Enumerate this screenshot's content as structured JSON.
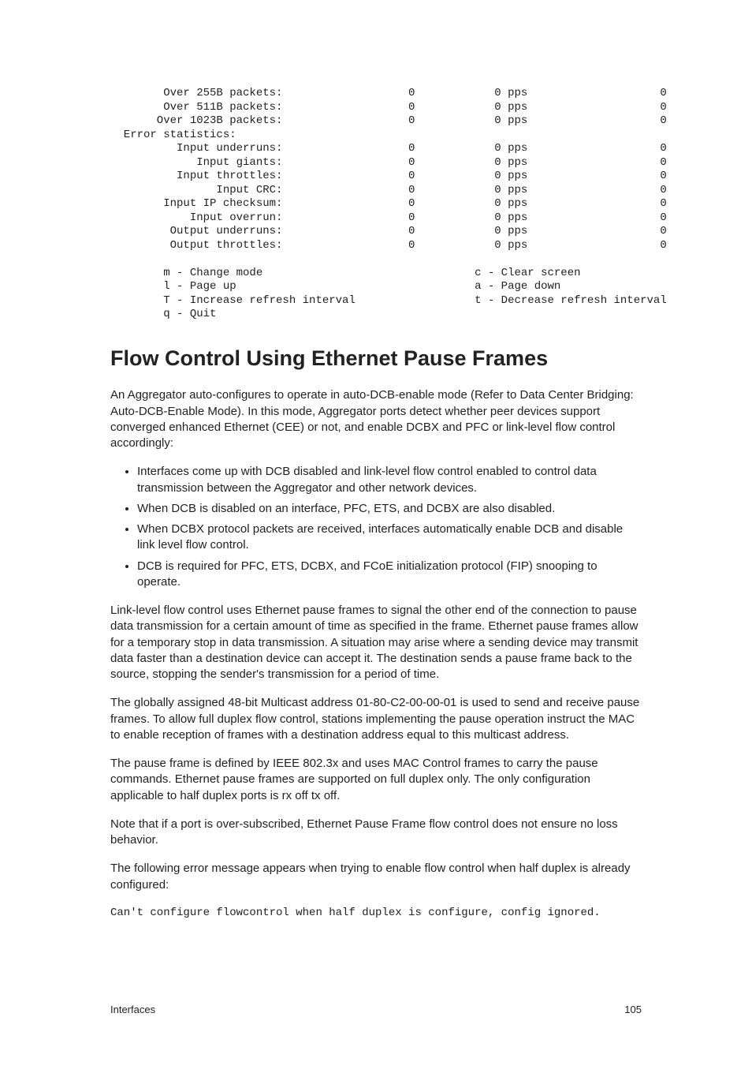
{
  "stats": {
    "rows": [
      {
        "label": "Over 255B packets:",
        "c1": "0",
        "c2": "0 pps",
        "c3": "0",
        "indent": 8
      },
      {
        "label": "Over 511B packets:",
        "c1": "0",
        "c2": "0 pps",
        "c3": "0",
        "indent": 8
      },
      {
        "label": "Over 1023B packets:",
        "c1": "0",
        "c2": "0 pps",
        "c3": "0",
        "indent": 7
      },
      {
        "label": "Error statistics:",
        "c1": "",
        "c2": "",
        "c3": "",
        "indent": 2
      },
      {
        "label": "Input underruns:",
        "c1": "0",
        "c2": "0 pps",
        "c3": "0",
        "indent": 10
      },
      {
        "label": "Input giants:",
        "c1": "0",
        "c2": "0 pps",
        "c3": "0",
        "indent": 13
      },
      {
        "label": "Input throttles:",
        "c1": "0",
        "c2": "0 pps",
        "c3": "0",
        "indent": 10
      },
      {
        "label": "Input CRC:",
        "c1": "0",
        "c2": "0 pps",
        "c3": "0",
        "indent": 16
      },
      {
        "label": "Input IP checksum:",
        "c1": "0",
        "c2": "0 pps",
        "c3": "0",
        "indent": 8
      },
      {
        "label": "Input overrun:",
        "c1": "0",
        "c2": "0 pps",
        "c3": "0",
        "indent": 12
      },
      {
        "label": "Output underruns:",
        "c1": "0",
        "c2": "0 pps",
        "c3": "0",
        "indent": 9
      },
      {
        "label": "Output throttles:",
        "c1": "0",
        "c2": "0 pps",
        "c3": "0",
        "indent": 9
      }
    ],
    "help": {
      "left": [
        "m - Change mode",
        "l - Page up",
        "T - Increase refresh interval",
        "q - Quit"
      ],
      "right": [
        "c - Clear screen",
        "a - Page down",
        "t - Decrease refresh interval"
      ]
    }
  },
  "heading": "Flow Control Using Ethernet Pause Frames",
  "paragraphs": {
    "p1": "An Aggregator auto-configures to operate in auto-DCB-enable mode (Refer to Data Center Bridging: Auto-DCB-Enable Mode). In this mode, Aggregator ports detect whether peer devices support converged enhanced Ethernet (CEE) or not, and enable DCBX and PFC or link-level flow control accordingly:",
    "bullets": [
      "Interfaces come up with DCB disabled and link-level flow control enabled to control data transmission between the Aggregator and other network devices.",
      "When DCB is disabled on an interface, PFC, ETS, and DCBX are also disabled.",
      "When DCBX protocol packets are received, interfaces automatically enable DCB and disable link level flow control.",
      "DCB is required for PFC, ETS, DCBX, and FCoE initialization protocol (FIP) snooping to operate."
    ],
    "p2": "Link-level flow control uses Ethernet pause frames to signal the other end of the connection to pause data transmission for a certain amount of time as specified in the frame. Ethernet pause frames allow for a temporary stop in data transmission. A situation may arise where a sending device may transmit data faster than a destination device can accept it. The destination sends a pause frame back to the source, stopping the sender's transmission for a period of time.",
    "p3": "The globally assigned 48-bit Multicast address 01-80-C2-00-00-01 is used to send and receive pause frames. To allow full duplex flow control, stations implementing the pause operation instruct the MAC to enable reception of frames with a destination address equal to this multicast address.",
    "p4": "The pause frame is defined by IEEE 802.3x and uses MAC Control frames to carry the pause commands. Ethernet pause frames are supported on full duplex only. The only configuration applicable to half duplex ports is rx off tx off.",
    "p5": "Note that if a port is over-subscribed, Ethernet Pause Frame flow control does not ensure no loss behavior.",
    "p6": "The following error message appears when trying to enable flow control when half duplex is already configured:",
    "err": "Can't configure flowcontrol when half duplex is configure, config ignored."
  },
  "footer": {
    "left": "Interfaces",
    "right": "105"
  }
}
